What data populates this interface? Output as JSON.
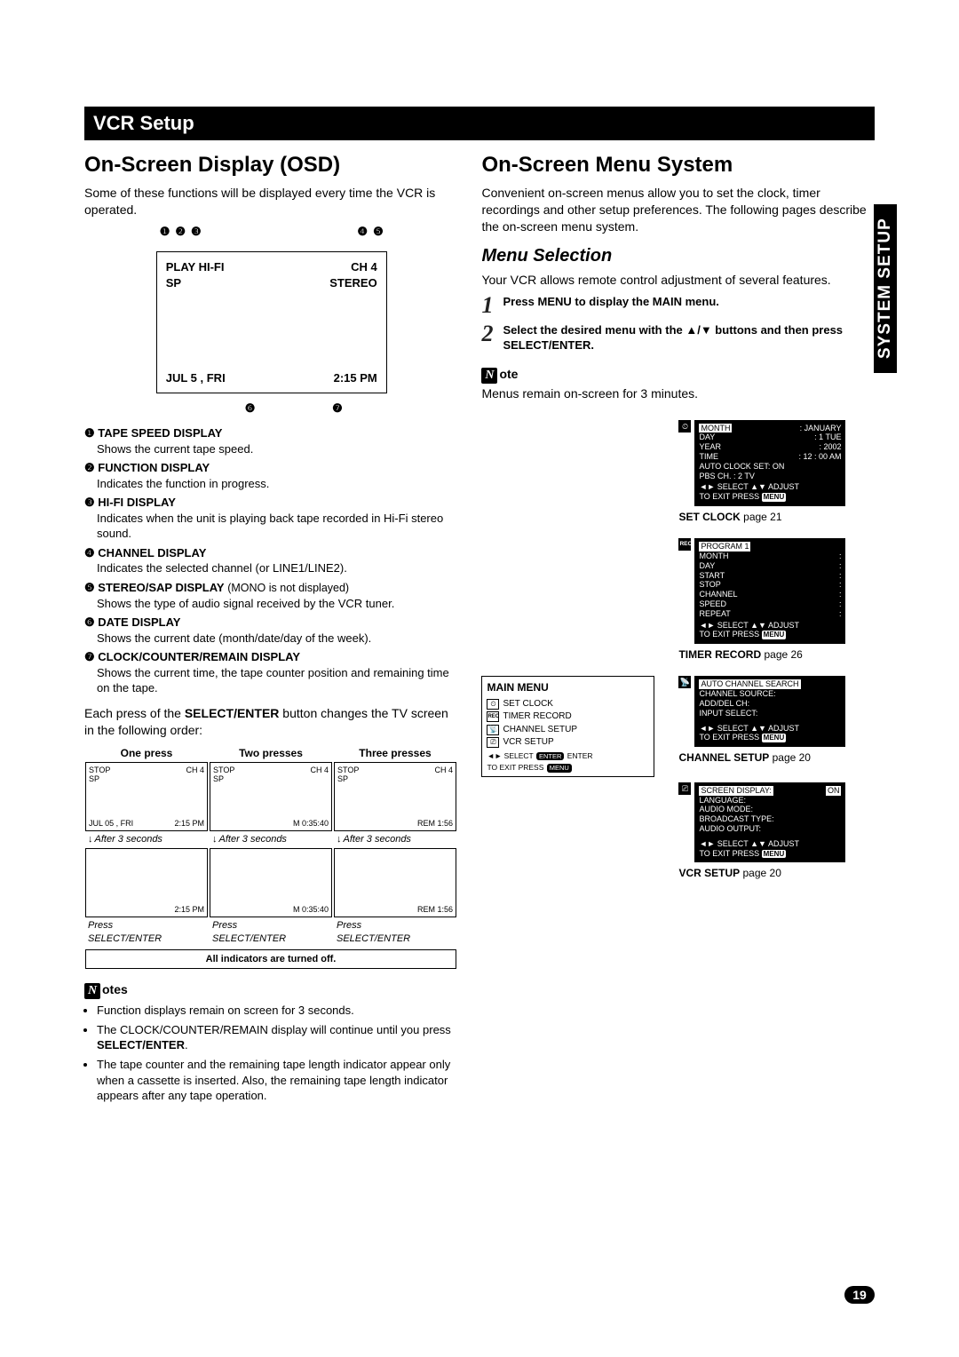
{
  "side_tab": "SYSTEM SETUP",
  "page_number": "19",
  "black_bar_title": "VCR Setup",
  "left": {
    "heading": "On-Screen Display (OSD)",
    "intro": "Some of these functions will be displayed every time the VCR is operated.",
    "osd_labels_top": [
      "❶",
      "❷",
      "❸",
      "❹",
      "❺"
    ],
    "osd_labels_bot": [
      "❻",
      "❼"
    ],
    "osd_box": {
      "play": "PLAY HI-FI",
      "ch": "CH   4",
      "sp": "SP",
      "stereo": "STEREO",
      "date": "JUL   5 , FRI",
      "time": "2:15 PM"
    },
    "items": [
      {
        "n": "❶",
        "title": "TAPE SPEED DISPLAY",
        "desc": "Shows the current tape speed."
      },
      {
        "n": "❷",
        "title": "FUNCTION DISPLAY",
        "desc": "Indicates the function in progress."
      },
      {
        "n": "❸",
        "title": "HI-FI DISPLAY",
        "desc": "Indicates when the unit is playing back tape recorded in Hi-Fi stereo sound."
      },
      {
        "n": "❹",
        "title": "CHANNEL DISPLAY",
        "desc": "Indicates the selected channel (or LINE1/LINE2)."
      },
      {
        "n": "❺",
        "title": "STEREO/SAP DISPLAY",
        "inline": " (MONO is not displayed)",
        "desc": "Shows the type of audio signal received by the VCR tuner."
      },
      {
        "n": "❻",
        "title": "DATE DISPLAY",
        "desc": "Shows the current date (month/date/day of the week)."
      },
      {
        "n": "❼",
        "title": "CLOCK/COUNTER/REMAIN DISPLAY",
        "desc": "Shows the current time, the tape counter position and remaining time on the tape."
      }
    ],
    "each_press_pre": "Each press of the ",
    "each_press_bold": "SELECT/ENTER",
    "each_press_post": " button changes the TV screen in the following order:",
    "grid": {
      "headers": [
        "One press",
        "Two presses",
        "Three presses"
      ],
      "top_row": [
        {
          "tl": "STOP",
          "tr": "CH 4",
          "tl2": "SP",
          "bl": "JUL 05 , FRI",
          "br": "2:15 PM"
        },
        {
          "tl": "STOP",
          "tr": "CH 4",
          "tl2": "SP",
          "br": "M 0:35:40"
        },
        {
          "tl": "STOP",
          "tr": "CH 4",
          "tl2": "SP",
          "br": "REM 1:56"
        }
      ],
      "between_top": [
        "After 3 seconds",
        "After 3 seconds",
        "After 3 seconds"
      ],
      "bottom_row": [
        {
          "br": "2:15 PM"
        },
        {
          "br": "M 0:35:40"
        },
        {
          "br": "REM 1:56"
        }
      ],
      "between_bot": [
        "Press\nSELECT/ENTER",
        "Press\nSELECT/ENTER",
        "Press\nSELECT/ENTER"
      ],
      "footer": "All indicators are turned off."
    },
    "notes_label": "otes",
    "notes": [
      "Function displays remain on screen for 3 seconds.",
      "The CLOCK/COUNTER/REMAIN display will continue until you press SELECT/ENTER.",
      "The tape counter and the remaining tape length indicator appear only when a cassette is inserted. Also, the remaining tape length indicator appears after any tape operation."
    ]
  },
  "right": {
    "heading": "On-Screen Menu System",
    "intro": "Convenient on-screen menus allow you to set the clock, timer recordings and other setup preferences. The following pages describe the on-screen menu system.",
    "sub": "Menu Selection",
    "sub_intro": "Your VCR allows remote control adjustment of several features.",
    "steps": [
      {
        "n": "1",
        "text": "Press MENU to display the MAIN menu."
      },
      {
        "n": "2",
        "text": "Select the desired menu with the ▲/▼ buttons and then press SELECT/ENTER."
      }
    ],
    "note_label": "ote",
    "note_text": "Menus remain on-screen for 3 minutes.",
    "mainmenu": {
      "title": "MAIN MENU",
      "items": [
        "SET  CLOCK",
        "TIMER  RECORD",
        "CHANNEL  SETUP",
        "VCR  SETUP"
      ],
      "icons": [
        "⏲",
        "REC",
        "📡",
        "⎚"
      ],
      "footer1_pref": "◄► SELECT ",
      "footer1_badge": "ENTER",
      "footer1_suf": " ENTER",
      "footer2_pref": "TO  EXIT  PRESS ",
      "footer2_badge": "MENU"
    },
    "panels": [
      {
        "ref_pre": "SET CLOCK",
        "ref_suf": " page 21",
        "lines": [
          [
            "MONTH",
            ": JANUARY",
            "hl"
          ],
          [
            "DAY",
            ": 1  TUE"
          ],
          [
            "YEAR",
            ": 2002"
          ],
          [
            "TIME",
            ": 12 : 00  AM"
          ],
          [
            "AUTO CLOCK SET: ON",
            ""
          ],
          [
            "PBS CH.  :    2       TV",
            ""
          ]
        ],
        "foot1": "◄► SELECT   ▲▼ ADJUST",
        "foot2_pref": "TO  EXIT  PRESS ",
        "foot2_badge": "MENU",
        "icon": "⏲"
      },
      {
        "ref_pre": "TIMER RECORD",
        "ref_suf": " page 26",
        "lines": [
          [
            "PROGRAM  1",
            "",
            "hl"
          ],
          [
            "MONTH",
            ":"
          ],
          [
            "DAY",
            ":"
          ],
          [
            "START",
            ":"
          ],
          [
            "STOP",
            ":"
          ],
          [
            "CHANNEL",
            ":"
          ],
          [
            "SPEED",
            ":"
          ],
          [
            "REPEAT",
            ":"
          ]
        ],
        "foot1": "◄► SELECT   ▲▼ ADJUST",
        "foot2_pref": "TO  EXIT  PRESS ",
        "foot2_badge": "MENU",
        "icon": "REC"
      },
      {
        "ref_pre": "CHANNEL SETUP",
        "ref_suf": " page 20",
        "lines": [
          [
            "AUTO  CHANNEL  SEARCH",
            "",
            "hl"
          ],
          [
            "CHANNEL  SOURCE:",
            ""
          ],
          [
            "ADD/DEL  CH:",
            ""
          ],
          [
            "INPUT  SELECT:",
            ""
          ]
        ],
        "foot1": "◄► SELECT   ▲▼ ADJUST",
        "foot2_pref": "TO  EXIT  PRESS ",
        "foot2_badge": "MENU",
        "icon": "📡"
      },
      {
        "ref_pre": "VCR SETUP",
        "ref_suf": " page 20",
        "lines": [
          [
            "SCREEN  DISPLAY:",
            "ON",
            "hl"
          ],
          [
            "LANGUAGE:",
            ""
          ],
          [
            "AUDIO MODE:",
            ""
          ],
          [
            "BROADCAST  TYPE:",
            ""
          ],
          [
            "AUDIO OUTPUT:",
            ""
          ]
        ],
        "foot1": "◄► SELECT   ▲▼ ADJUST",
        "foot2_pref": "TO  EXIT  PRESS ",
        "foot2_badge": "MENU",
        "icon": "⎚"
      }
    ]
  }
}
